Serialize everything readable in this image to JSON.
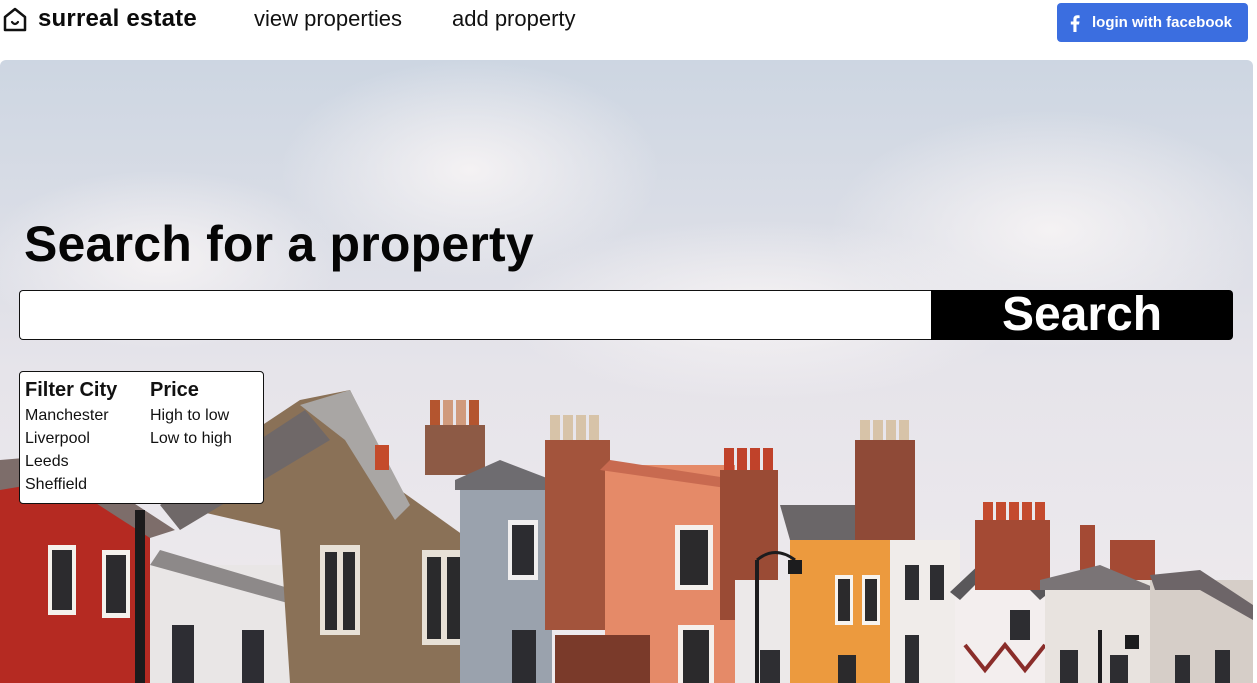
{
  "brand": {
    "name": "surreal estate",
    "icon": "home-icon"
  },
  "nav": {
    "view_properties": "view properties",
    "add_property": "add property"
  },
  "login": {
    "label": "login with facebook",
    "icon": "facebook-icon",
    "color": "#3b6ee0"
  },
  "hero": {
    "title": "Search for a property",
    "search_value": "",
    "search_button": "Search",
    "background": "photo of a row of colourful terraced houses with chimneys under a cloudy sky"
  },
  "filters": {
    "city": {
      "heading": "Filter City",
      "options": [
        "Manchester",
        "Liverpool",
        "Leeds",
        "Sheffield"
      ]
    },
    "price": {
      "heading": "Price",
      "options": [
        "High to low",
        "Low to high"
      ]
    }
  }
}
